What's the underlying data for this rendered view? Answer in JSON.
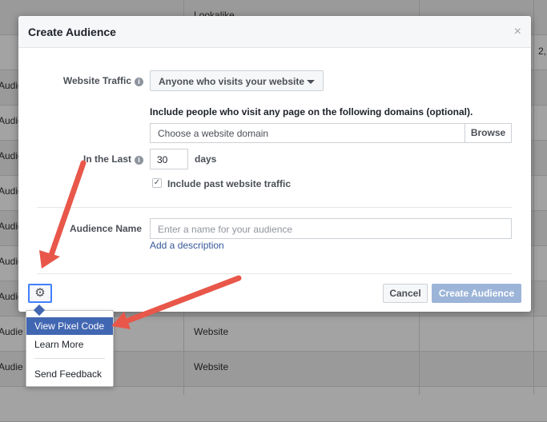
{
  "background": {
    "top_cell": "Lookalike",
    "top_right_value": "2,",
    "row_label": "Audie",
    "row_labels": [
      "Audie",
      "Audie",
      "Audie",
      "Audie",
      "Audie",
      "Audie",
      "Audie",
      "Audie",
      "Audie",
      "Audie"
    ],
    "website_cells": [
      "Website",
      "Website"
    ]
  },
  "modal": {
    "title": "Create Audience",
    "close": "×",
    "website_traffic_label": "Website Traffic",
    "info_glyph": "i",
    "traffic_option": "Anyone who visits your website",
    "domains_help": "Include people who visit any page on the following domains (optional).",
    "domain_placeholder": "Choose a website domain",
    "browse_label": "Browse",
    "in_the_last_label": "In the Last",
    "days_value": "30",
    "days_label": "days",
    "checkbox_mark": "✓",
    "include_past_label": "Include past website traffic",
    "audience_name_label": "Audience Name",
    "audience_name_placeholder": "Enter a name for your audience",
    "add_description": "Add a description",
    "gear_glyph": "⚙",
    "cancel_label": "Cancel",
    "create_label": "Create Audience"
  },
  "menu": {
    "items": [
      "View Pixel Code",
      "Learn More",
      "Send Feedback"
    ]
  },
  "colors": {
    "arrow": "#e8574a",
    "accent": "#4267b2",
    "link": "#365899",
    "create_button": "#9cb4d8"
  }
}
